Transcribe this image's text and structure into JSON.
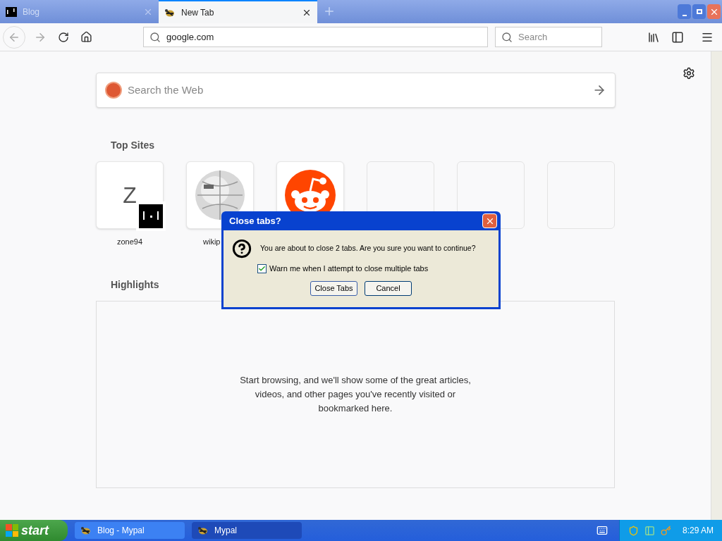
{
  "tabs": [
    {
      "title": "Blog",
      "kind": "blog",
      "selected": false
    },
    {
      "title": "New Tab",
      "kind": "newtab",
      "selected": true
    }
  ],
  "address": {
    "value": "google.com"
  },
  "search": {
    "placeholder": "Search"
  },
  "page": {
    "search": {
      "placeholder": "Search the Web"
    },
    "top_sites": {
      "title": "Top Sites",
      "tiles": [
        {
          "kind": "letter",
          "letter": "Z",
          "label": "zone94"
        },
        {
          "kind": "globe",
          "label": "wikip"
        },
        {
          "kind": "alien"
        },
        {
          "kind": "empty"
        },
        {
          "kind": "empty"
        },
        {
          "kind": "empty"
        }
      ]
    },
    "highlights": {
      "title": "Highlights",
      "message": "Start browsing, and we'll show some of the great articles, videos, and other pages you've recently visited or bookmarked here."
    }
  },
  "dialog": {
    "title": "Close tabs?",
    "message": "You are about to close 2 tabs. Are you sure you want to continue?",
    "checkbox": {
      "label": "Warn me when I attempt to close multiple tabs",
      "checked": true
    },
    "buttons": [
      "Close Tabs",
      "Cancel"
    ]
  },
  "taskbar": {
    "start": "start",
    "tasks": [
      {
        "title": "Blog - Mypal",
        "selected": false
      },
      {
        "title": "Mypal",
        "selected": true
      }
    ],
    "clock": "8:29 AM"
  }
}
